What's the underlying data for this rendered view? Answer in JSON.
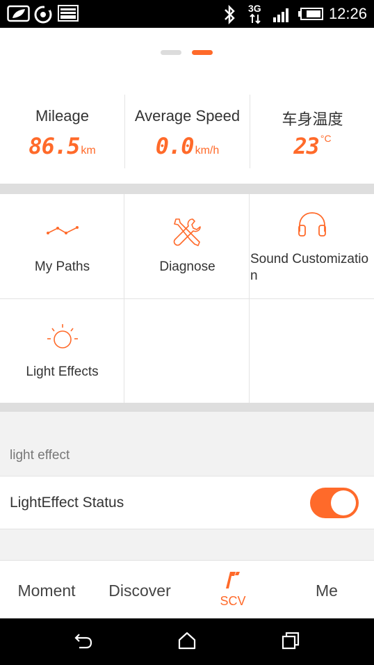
{
  "status_bar": {
    "time": "12:26",
    "network": "3G",
    "left_icons": [
      "leaf-message-icon",
      "sync-icon",
      "image-icon"
    ],
    "right_icons": [
      "bluetooth-icon",
      "network-arrows-icon",
      "signal-icon",
      "battery-icon"
    ]
  },
  "pager": {
    "page_count": 2,
    "active_index": 1
  },
  "stats": {
    "mileage": {
      "label": "Mileage",
      "value": "86.5",
      "unit": "km"
    },
    "speed": {
      "label": "Average Speed",
      "value": "0.0",
      "unit": "km/h"
    },
    "temperature": {
      "label": "车身温度",
      "value": "23",
      "unit": "°C"
    }
  },
  "grid": {
    "my_paths": {
      "label": "My Paths",
      "icon": "path-chart-icon"
    },
    "diagnose": {
      "label": "Diagnose",
      "icon": "wrench-screwdriver-icon"
    },
    "sound": {
      "label_line1": "Sound Customizatio",
      "label_line2": "n",
      "icon": "headphones-icon"
    },
    "light": {
      "label": "Light Effects",
      "icon": "sun-icon"
    }
  },
  "light_effect": {
    "section_title": "light effect",
    "status_label": "LightEffect Status",
    "status_on": true
  },
  "tabs": {
    "moment": "Moment",
    "discover": "Discover",
    "scv": "SCV",
    "me": "Me",
    "active": "SCV"
  },
  "colors": {
    "accent": "#ff6a2a",
    "separator": "#dedede",
    "section_bg": "#f2f2f2"
  },
  "nav_bar": {
    "buttons": [
      "back-icon",
      "home-icon",
      "recents-icon"
    ]
  }
}
